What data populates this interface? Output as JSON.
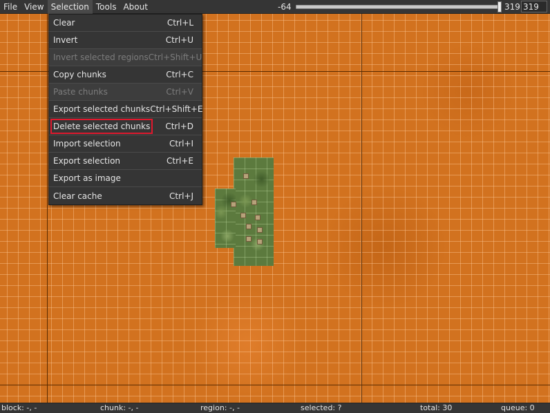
{
  "menubar": {
    "items": [
      {
        "label": "File"
      },
      {
        "label": "View"
      },
      {
        "label": "Selection"
      },
      {
        "label": "Tools"
      },
      {
        "label": "About"
      }
    ]
  },
  "y_range": {
    "min_label": "-64",
    "max_label": "319",
    "input_value": "319",
    "slider_fraction": 1.0
  },
  "selection_menu": {
    "items": [
      {
        "label": "Clear",
        "shortcut": "Ctrl+L",
        "enabled": true
      },
      {
        "label": "Invert",
        "shortcut": "Ctrl+U",
        "enabled": true
      },
      {
        "label": "Invert selected regions",
        "shortcut": "Ctrl+Shift+U",
        "enabled": false
      },
      {
        "label": "Copy chunks",
        "shortcut": "Ctrl+C",
        "enabled": true
      },
      {
        "label": "Paste chunks",
        "shortcut": "Ctrl+V",
        "enabled": false
      },
      {
        "label": "Export selected chunks",
        "shortcut": "Ctrl+Shift+E",
        "enabled": true
      },
      {
        "label": "Delete selected chunks",
        "shortcut": "Ctrl+D",
        "enabled": true,
        "highlighted": true
      },
      {
        "label": "Import selection",
        "shortcut": "Ctrl+I",
        "enabled": true
      },
      {
        "label": "Export selection",
        "shortcut": "Ctrl+E",
        "enabled": true
      },
      {
        "label": "Export as image",
        "shortcut": "",
        "enabled": true
      },
      {
        "label": "Clear cache",
        "shortcut": "Ctrl+J",
        "enabled": true
      }
    ]
  },
  "status": {
    "block": "block: -, -",
    "chunk": "chunk: -, -",
    "region": "region: -, -",
    "selected": "selected: ?",
    "total": "total: 30",
    "queue": "queue: 0"
  },
  "colors": {
    "selection_overlay": "#d2721f",
    "highlight_outline": "#e0182d",
    "menu_bg": "#353535"
  }
}
